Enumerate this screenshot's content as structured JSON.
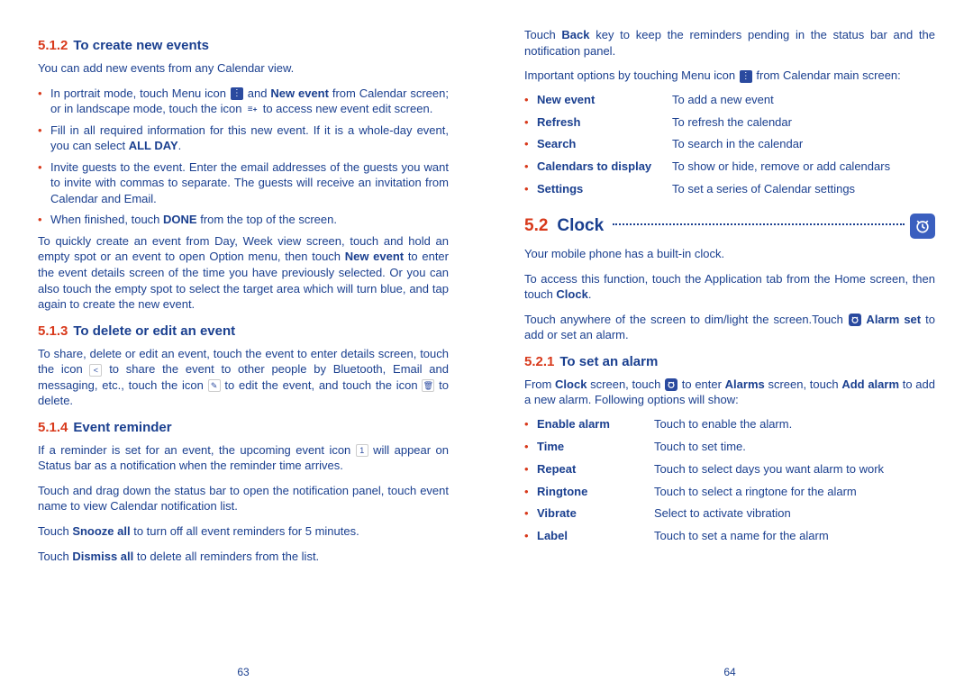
{
  "left": {
    "h512_num": "5.1.2",
    "h512_title": "To create new events",
    "p1": "You can add new events from any Calendar view.",
    "b1_a": "In portrait mode, touch Menu icon ",
    "b1_b": " and ",
    "b1_c": "New event",
    "b1_d": " from Calendar screen; or in landscape mode, touch the icon ",
    "b1_e": " to access new event edit screen.",
    "b2_a": "Fill in all required information for this new event. If it is a whole-day event, you can select ",
    "b2_b": "ALL DAY",
    "b2_c": ".",
    "b3": "Invite guests to the event. Enter the email addresses of the guests you want to invite with commas to separate. The guests will receive an invitation from Calendar and Email.",
    "b4_a": "When finished, touch ",
    "b4_b": "DONE",
    "b4_c": " from the top of the screen.",
    "p2_a": "To quickly create an event from Day, Week view screen, touch and hold an empty spot or an event to open Option menu, then touch ",
    "p2_b": "New event",
    "p2_c": " to enter the event details screen of the time you have previously selected. Or you can also touch the empty spot to select the target area which will turn blue, and tap again to create the new event.",
    "h513_num": "5.1.3",
    "h513_title": "To delete or edit an event",
    "p3_a": "To share, delete or edit an event, touch the event to enter details screen, touch the icon ",
    "p3_b": " to share the event to other people by Bluetooth, Email and messaging, etc., touch  the icon ",
    "p3_c": " to edit the event, and touch the icon ",
    "p3_d": " to delete.",
    "h514_num": "5.1.4",
    "h514_title": "Event reminder",
    "p4_a": "If a reminder is set for an event, the upcoming event icon ",
    "p4_b": " will appear on Status bar as a notification when the reminder time arrives.",
    "p5": "Touch and drag down the status bar to open the notification panel, touch event name to view Calendar notification list.",
    "p6_a": "Touch ",
    "p6_b": "Snooze all",
    "p6_c": " to turn off all event reminders for 5 minutes.",
    "p7_a": "Touch ",
    "p7_b": "Dismiss all",
    "p7_c": " to delete all reminders from the list.",
    "page_num": "63"
  },
  "right": {
    "p1_a": "Touch ",
    "p1_b": "Back",
    "p1_c": " key to keep the reminders pending in the status bar and the notification panel.",
    "p2_a": "Important options by touching Menu icon ",
    "p2_b": " from Calendar main screen:",
    "opts1": [
      {
        "label": "New event",
        "desc": "To add a new event"
      },
      {
        "label": "Refresh",
        "desc": "To refresh the calendar"
      },
      {
        "label": "Search",
        "desc": "To search in the calendar"
      },
      {
        "label": "Calendars to display",
        "desc": "To show or hide, remove or add calendars"
      },
      {
        "label": "Settings",
        "desc": "To set a series of Calendar settings"
      }
    ],
    "h52_num": "5.2",
    "h52_title": "Clock",
    "p3": "Your mobile phone has a built-in clock.",
    "p4_a": "To access this function, touch the Application tab from the Home screen, then touch ",
    "p4_b": "Clock",
    "p4_c": ".",
    "p5_a": "Touch anywhere of the screen to dim/light the screen.Touch ",
    "p5_b": " Alarm set",
    "p5_c": " to add or set an alarm.",
    "h521_num": "5.2.1",
    "h521_title": "To set an alarm",
    "p6_a": "From ",
    "p6_b": "Clock",
    "p6_c": " screen, touch ",
    "p6_d": " to enter ",
    "p6_e": "Alarms",
    "p6_f": " screen, touch ",
    "p6_g": "Add alarm",
    "p6_h": " to add a new alarm. Following options will show:",
    "opts2": [
      {
        "label": "Enable alarm",
        "desc": "Touch to enable the alarm."
      },
      {
        "label": "Time",
        "desc": "Touch to set time."
      },
      {
        "label": "Repeat",
        "desc": "Touch to select days you want alarm to work"
      },
      {
        "label": "Ringtone",
        "desc": "Touch to select a ringtone for the alarm"
      },
      {
        "label": "Vibrate",
        "desc": "Select to activate vibration"
      },
      {
        "label": "Label",
        "desc": "Touch to set a name for the alarm"
      }
    ],
    "page_num": "64"
  }
}
